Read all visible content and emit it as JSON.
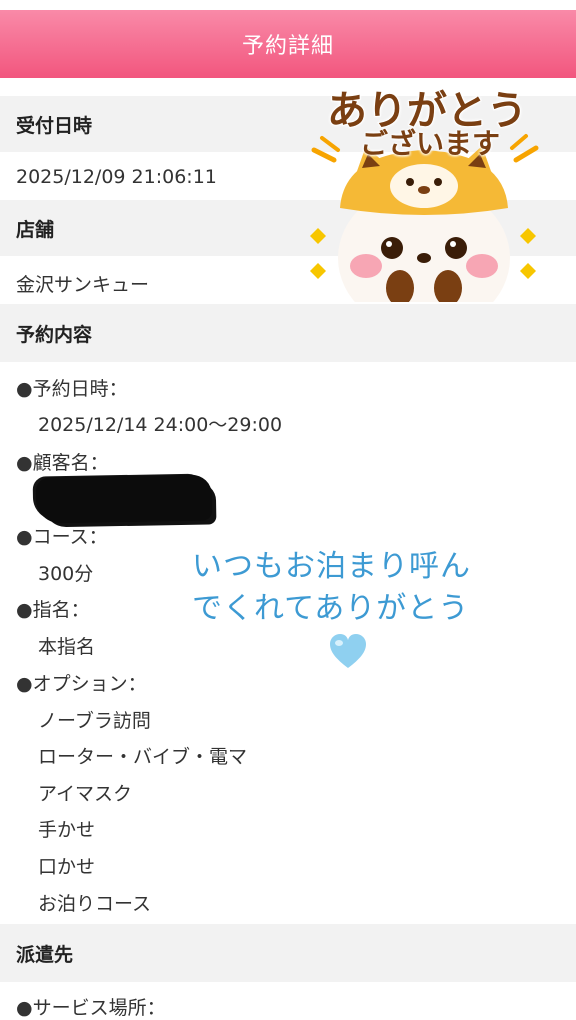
{
  "header": {
    "title": "予約詳細"
  },
  "received": {
    "label": "受付日時",
    "value": "2025/12/09 21:06:11"
  },
  "store": {
    "label": "店舗",
    "value": "金沢サンキュー"
  },
  "reservation": {
    "label": "予約内容",
    "date_label": "●予約日時：",
    "date_value": "2025/12/14 24:00〜29:00",
    "customer_label": "●顧客名：",
    "course_label": "●コース：",
    "course_value": "300分",
    "nomination_label": "●指名：",
    "nomination_value": "本指名",
    "options_label": "●オプション：",
    "options": [
      "ノーブラ訪問",
      "ローター・バイブ・電マ",
      "アイマスク",
      "手かせ",
      "口かせ",
      "お泊りコース"
    ]
  },
  "dispatch": {
    "label": "派遣先",
    "service_place_label": "●サービス場所："
  },
  "overlay": {
    "message_line1": "いつもお泊まり呼ん",
    "message_line2": "でくれてありがとう",
    "sticker_line1": "ありがとう",
    "sticker_line2": "ございます",
    "heart_color": "#8fd0f0",
    "message_color": "#3d9ad3"
  }
}
